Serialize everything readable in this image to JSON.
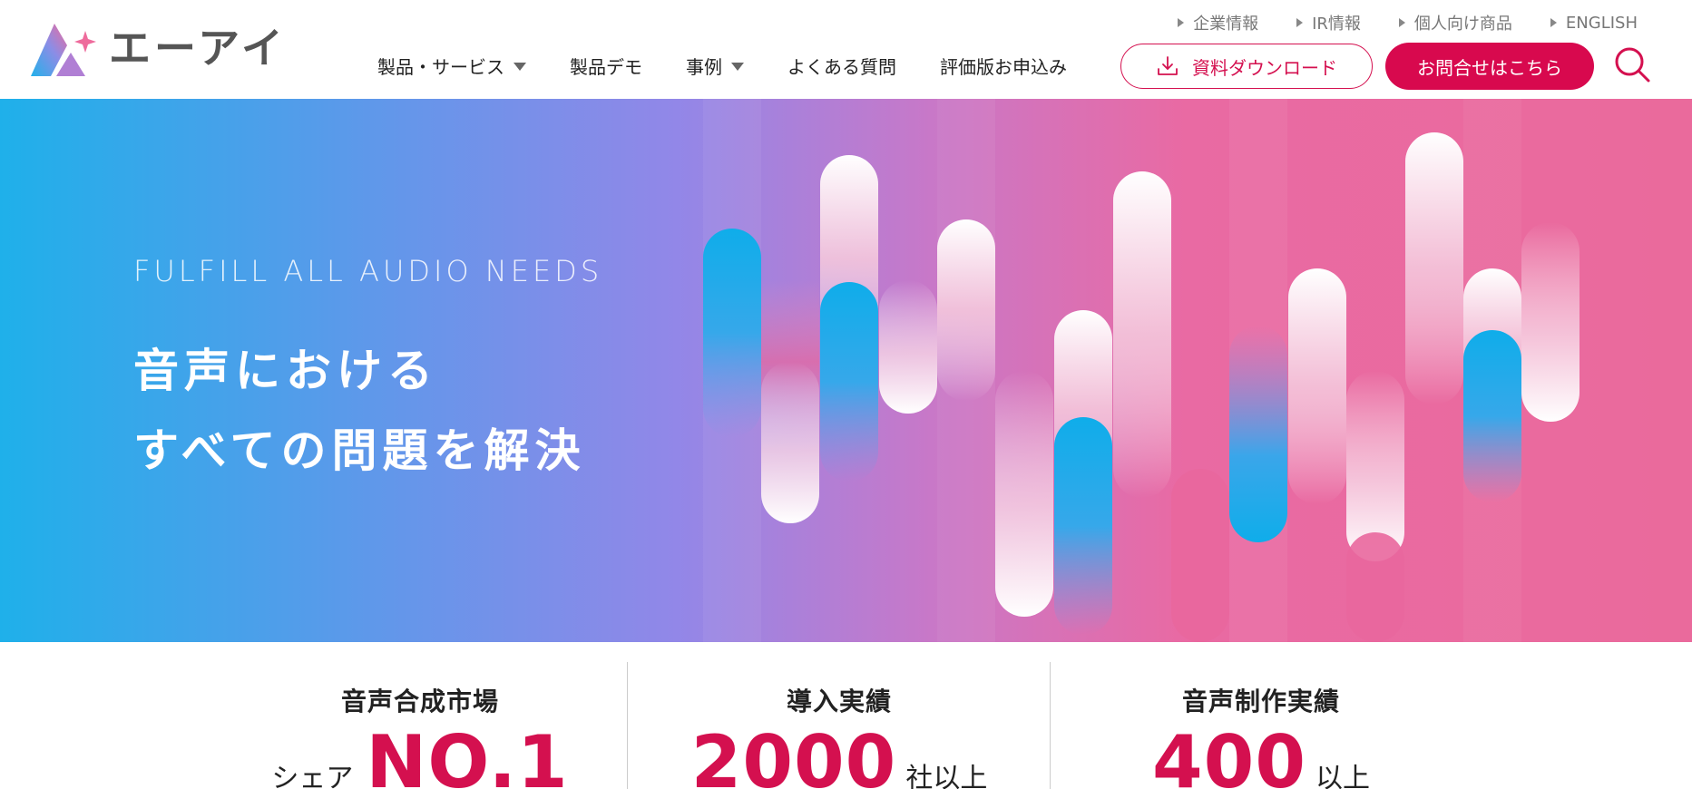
{
  "brand": {
    "name": "エーアイ",
    "colors": {
      "accent": "#d4104f",
      "logo_blue": "#22b1ea",
      "logo_pink": "#e96aa3"
    }
  },
  "utility_nav": [
    {
      "label": "企業情報",
      "icon": "triangle-right-icon"
    },
    {
      "label": "IR情報",
      "icon": "triangle-right-icon"
    },
    {
      "label": "個人向け商品",
      "icon": "triangle-right-icon"
    },
    {
      "label": "ENGLISH",
      "icon": "triangle-right-icon"
    }
  ],
  "main_nav": [
    {
      "label": "製品・サービス",
      "has_dropdown": true
    },
    {
      "label": "製品デモ",
      "has_dropdown": false
    },
    {
      "label": "事例",
      "has_dropdown": true
    },
    {
      "label": "よくある質問",
      "has_dropdown": false
    },
    {
      "label": "評価版お申込み",
      "has_dropdown": false
    }
  ],
  "buttons": {
    "download": {
      "label": "資料ダウンロード",
      "icon": "download-icon"
    },
    "contact": {
      "label": "お問合せはこちら"
    },
    "search": {
      "icon": "search-icon"
    }
  },
  "hero": {
    "tagline": "FULFILL ALL AUDIO NEEDS",
    "headline_line1": "音声における",
    "headline_line2": "すべての問題を解決"
  },
  "stats": [
    {
      "label": "音声合成市場",
      "prefix": "シェア",
      "value": "NO.1",
      "suffix": ""
    },
    {
      "label": "導入実績",
      "prefix": "",
      "value": "2000",
      "suffix": "社以上"
    },
    {
      "label": "音声制作実績",
      "prefix": "",
      "value": "400",
      "suffix": "以上"
    }
  ]
}
